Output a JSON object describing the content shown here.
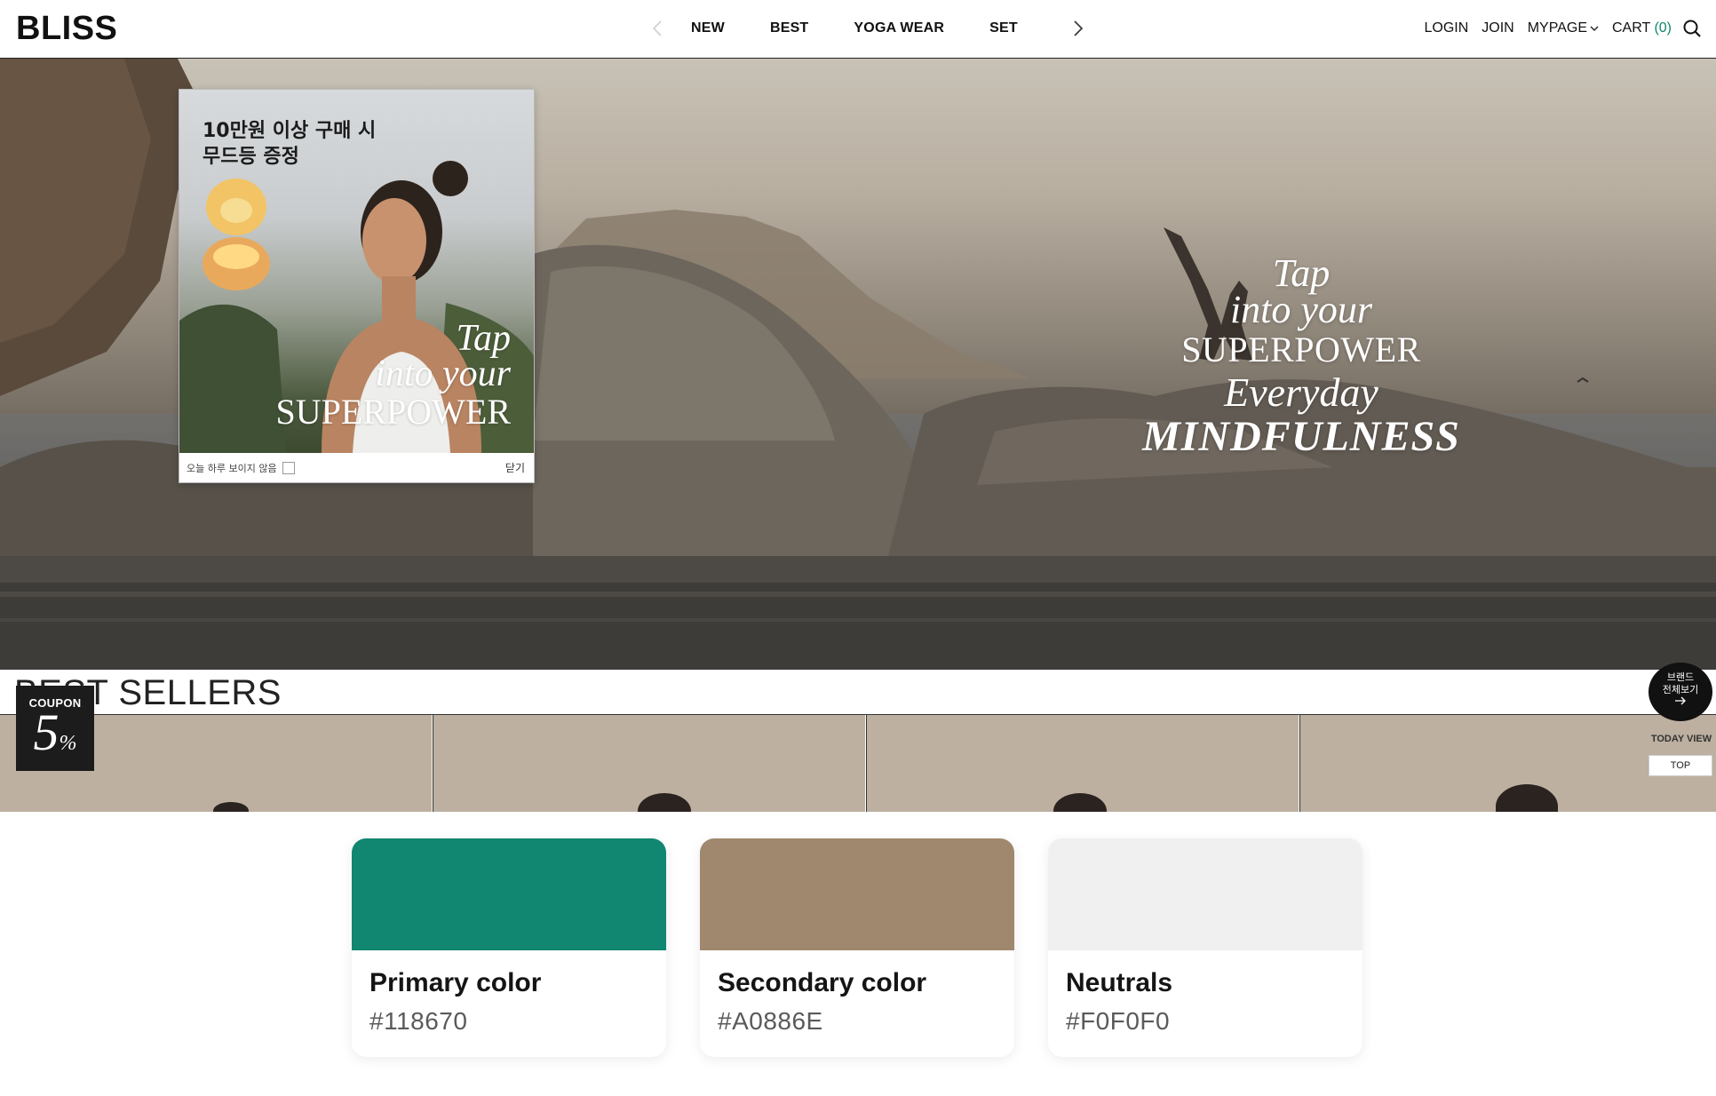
{
  "header": {
    "logo": "BLISS",
    "nav": [
      "NEW",
      "BEST",
      "YOGA WEAR",
      "SET"
    ],
    "login": "LOGIN",
    "join": "JOIN",
    "mypage": "MYPAGE",
    "cart_label": "CART",
    "cart_count": "(0)"
  },
  "hero": {
    "line1": "Tap",
    "line2": "into your",
    "line3": "SUPERPOWER",
    "line4": "Everyday",
    "line5": "MINDFULNESS"
  },
  "popup": {
    "headline_1": "10만원 이상 구매 시",
    "headline_2": "무드등 증정",
    "copy_1": "Tap",
    "copy_2": "into your",
    "copy_3": "SUPERPOWER",
    "hide_today": "오늘 하루 보이지 않음",
    "close": "닫기"
  },
  "best": {
    "title": "BEST SELLERS",
    "coupon_label": "COUPON",
    "coupon_value": "5",
    "coupon_unit": "%"
  },
  "side": {
    "brand_line1": "브랜드",
    "brand_line2": "전체보기",
    "today_view": "TODAY VIEW",
    "top": "TOP"
  },
  "colors": [
    {
      "name": "Primary color",
      "hex": "#118670"
    },
    {
      "name": "Secondary color",
      "hex": "#A0886E"
    },
    {
      "name": "Neutrals",
      "hex": "#F0F0F0"
    }
  ],
  "icons": {
    "nav_prev": "chevron-left-icon",
    "nav_next": "chevron-right-icon",
    "mypage_caret": "chevron-down-icon",
    "search": "search-icon",
    "brand_arrow": "arrow-right-icon"
  }
}
